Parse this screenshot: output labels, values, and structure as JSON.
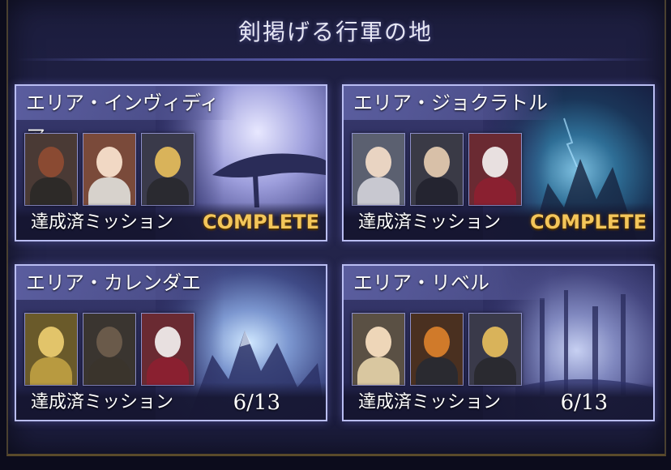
{
  "header": {
    "title": "剣掲げる行軍の地"
  },
  "mission_label": "達成済ミッション",
  "areas": [
    {
      "name": "エリア・インヴィディア",
      "status": "COMPLETE",
      "progress": ""
    },
    {
      "name": "エリア・ジョクラトル",
      "status": "COMPLETE",
      "progress": ""
    },
    {
      "name": "エリア・カレンダエ",
      "status": "",
      "progress": "6/13"
    },
    {
      "name": "エリア・リベル",
      "status": "",
      "progress": "6/13"
    }
  ],
  "colors": {
    "frame_bg": "#23244a",
    "card_border": "#b9bdf2",
    "complete_gold": "#f3c65a"
  }
}
